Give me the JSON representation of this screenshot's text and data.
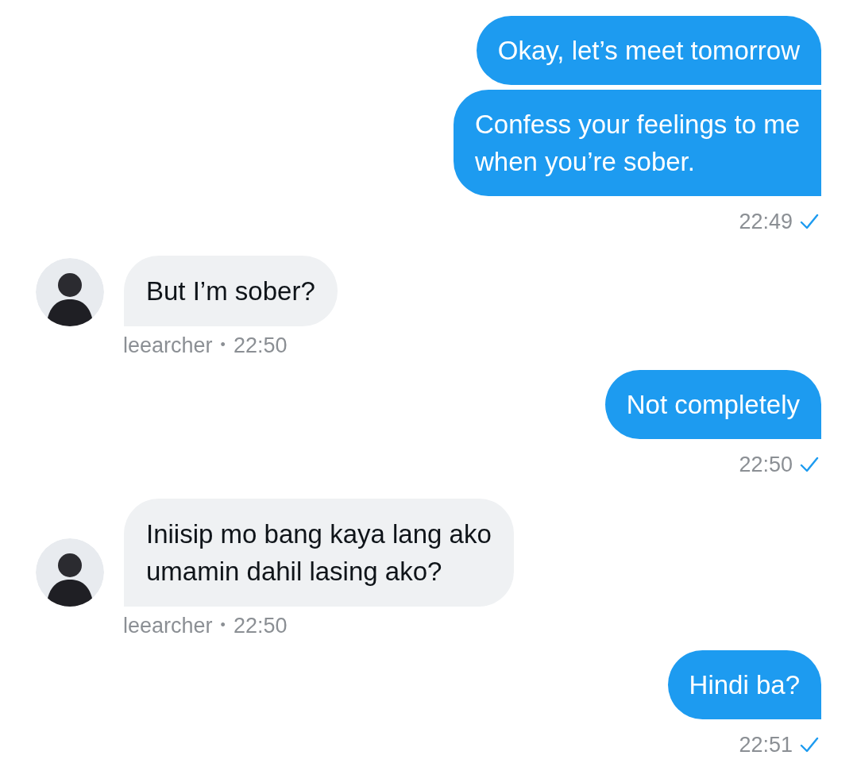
{
  "messages": [
    {
      "kind": "sent",
      "bubbles": [
        "Okay, let’s meet tomorrow",
        "Confess your feelings to me\nwhen you’re sober."
      ],
      "time": "22:49"
    },
    {
      "kind": "received",
      "bubbles": [
        "But I’m sober?"
      ],
      "username": "leearcher",
      "separator": "•",
      "time": "22:50"
    },
    {
      "kind": "sent",
      "bubbles": [
        "Not completely"
      ],
      "time": "22:50"
    },
    {
      "kind": "received",
      "bubbles": [
        "Iniisip mo bang kaya lang ako\numamin dahil lasing ako?"
      ],
      "username": "leearcher",
      "separator": "•",
      "time": "22:50"
    },
    {
      "kind": "sent",
      "bubbles": [
        "Hindi ba?"
      ],
      "time": "22:51"
    }
  ]
}
